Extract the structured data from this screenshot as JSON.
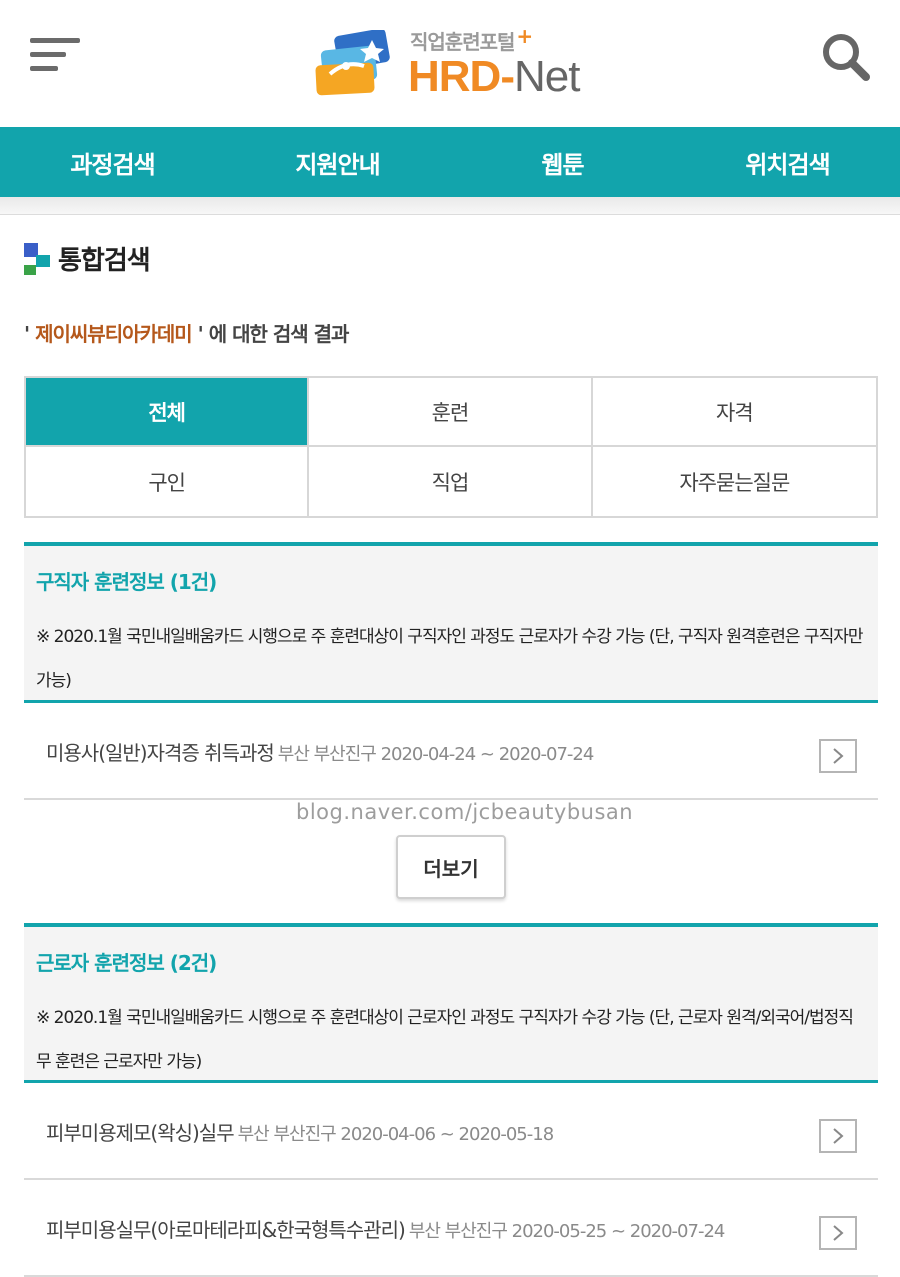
{
  "header": {
    "logo_subtitle": "직업훈련포털",
    "logo_plus": "+",
    "logo_main": "HRD-",
    "logo_main_net": "Net"
  },
  "nav": {
    "items": [
      {
        "label": "과정검색"
      },
      {
        "label": "지원안내"
      },
      {
        "label": "웹툰"
      },
      {
        "label": "위치검색"
      }
    ]
  },
  "section": {
    "title": "통합검색"
  },
  "search": {
    "quote_open": "' ",
    "keyword": "제이씨뷰티아카데미",
    "quote_close_suffix": " ' 에 대한 검색 결과"
  },
  "tabs": [
    {
      "label": "전체",
      "active": true
    },
    {
      "label": "훈련",
      "active": false
    },
    {
      "label": "자격",
      "active": false
    },
    {
      "label": "구인",
      "active": false
    },
    {
      "label": "직업",
      "active": false
    },
    {
      "label": "자주묻는질문",
      "active": false
    }
  ],
  "job_seeker": {
    "title": "구직자 훈련정보 (1건)",
    "note": "※ 2020.1월 국민내일배움카드 시행으로 주 훈련대상이 구직자인 과정도 근로자가 수강 가능 (단, 구직자 원격훈련은 구직자만 가능)",
    "courses": [
      {
        "name": "미용사(일반)자격증 취득과정",
        "meta": "부산 부산진구 2020-04-24 ~ 2020-07-24"
      }
    ],
    "more_label": "더보기"
  },
  "watermark": "blog.naver.com/jcbeautybusan",
  "worker": {
    "title": "근로자 훈련정보 (2건)",
    "note": "※ 2020.1월 국민내일배움카드 시행으로 주 훈련대상이 근로자인 과정도 구직자가 수강 가능 (단, 근로자 원격/외국어/법정직무 훈련은 근로자만 가능)",
    "courses": [
      {
        "name": "피부미용제모(왁싱)실무",
        "meta": "부산 부산진구 2020-04-06 ~ 2020-05-18"
      },
      {
        "name": "피부미용실무(아로마테라피&한국형특수관리)",
        "meta": "부산 부산진구 2020-05-25 ~ 2020-07-24"
      }
    ]
  },
  "colors": {
    "accent": "#12a4ac",
    "brand_orange": "#f08a24",
    "keyword": "#b5581b"
  },
  "icons": {
    "menu": "hamburger-icon",
    "search": "search-icon",
    "logo": "hrd-net-logo",
    "section": "section-squares-icon",
    "row_arrow": "chevron-right-icon"
  }
}
